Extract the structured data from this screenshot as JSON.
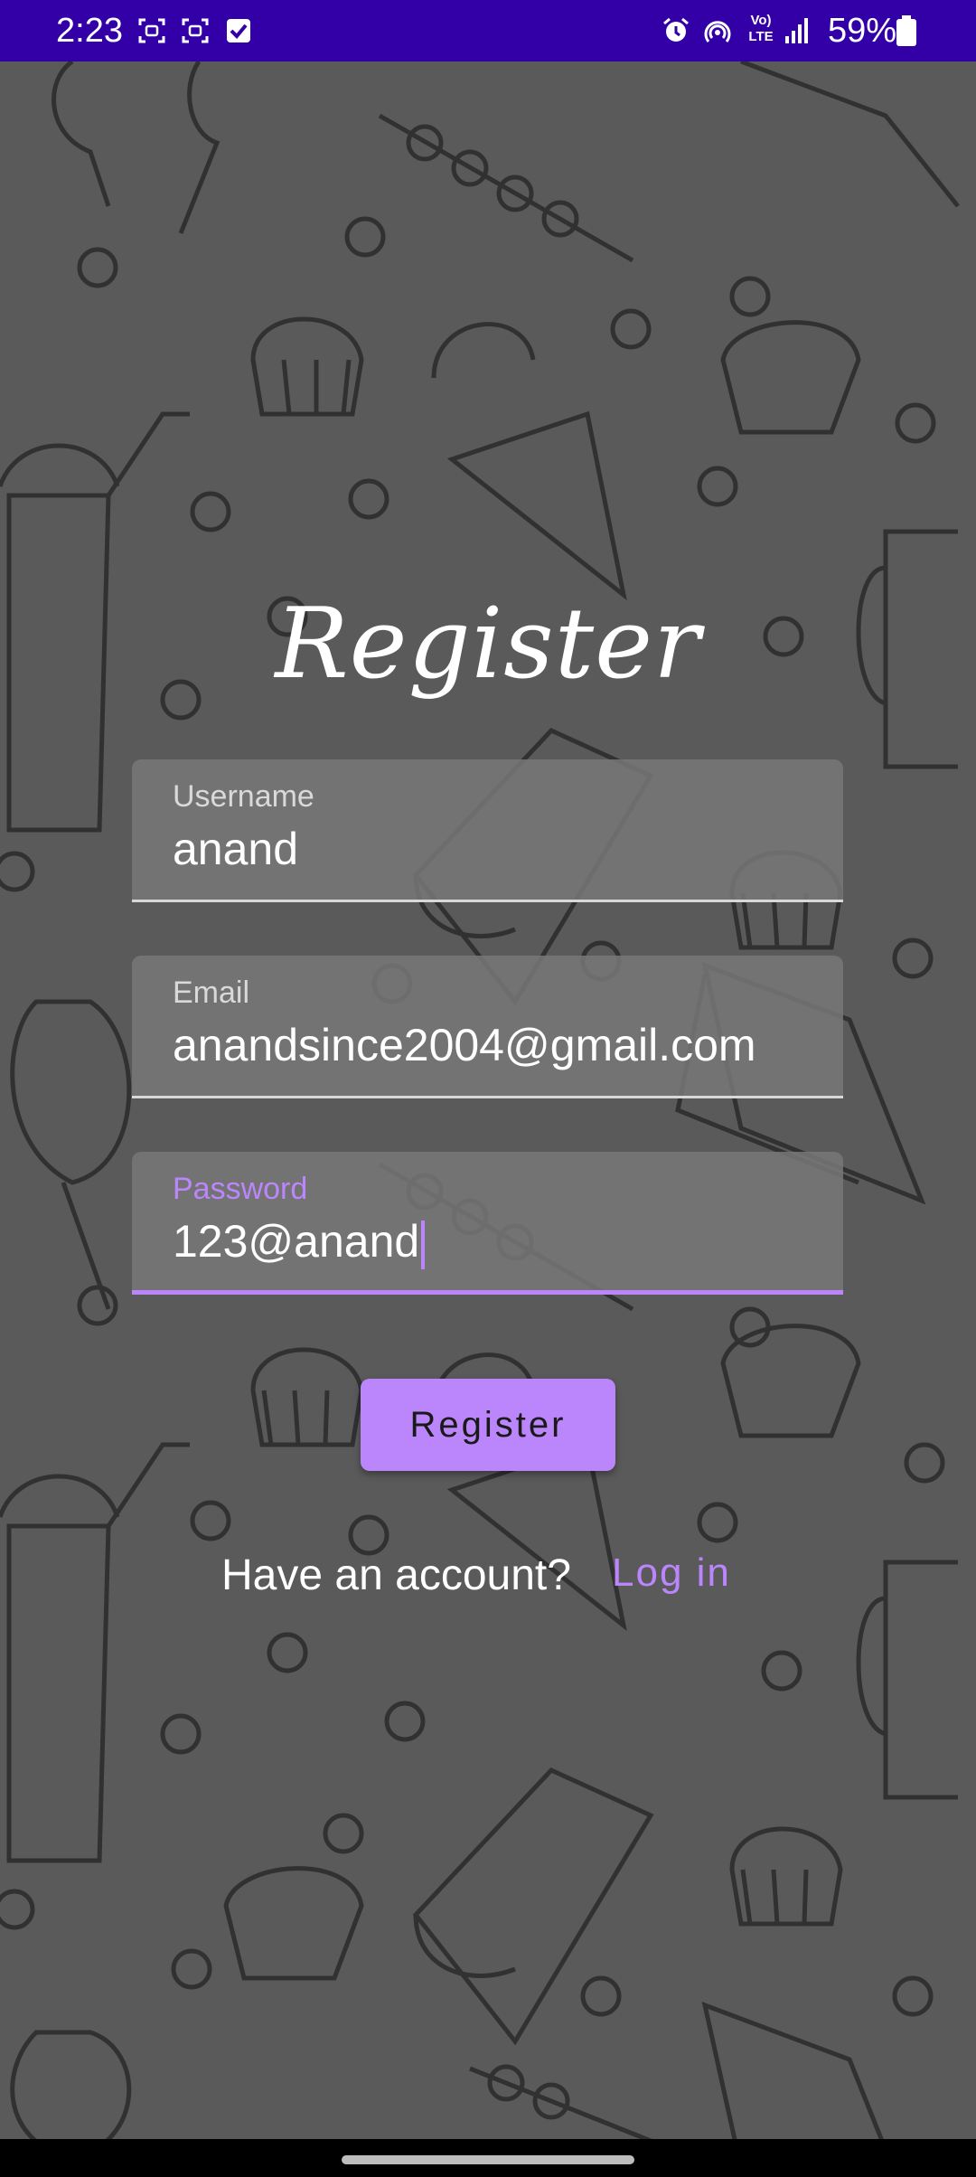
{
  "status_bar": {
    "time": "2:23",
    "battery_percent": "59%",
    "network_label": "Vo) LTE",
    "icons": [
      "screenshot-icon",
      "screenshot-icon",
      "checkbox-icon",
      "alarm-icon",
      "hotspot-icon",
      "volte-icon",
      "signal-icon",
      "battery-icon"
    ]
  },
  "title": "Register",
  "fields": {
    "username": {
      "label": "Username",
      "value": "anand"
    },
    "email": {
      "label": "Email",
      "value": "anandsince2004@gmail.com"
    },
    "password": {
      "label": "Password",
      "value": "123@anand"
    }
  },
  "register_button": "Register",
  "footer": {
    "prompt": "Have an account?",
    "login_link": "Log in"
  },
  "colors": {
    "status_bar": "#3300a8",
    "accent": "#bb86fc",
    "background": "#5a5a5a"
  }
}
